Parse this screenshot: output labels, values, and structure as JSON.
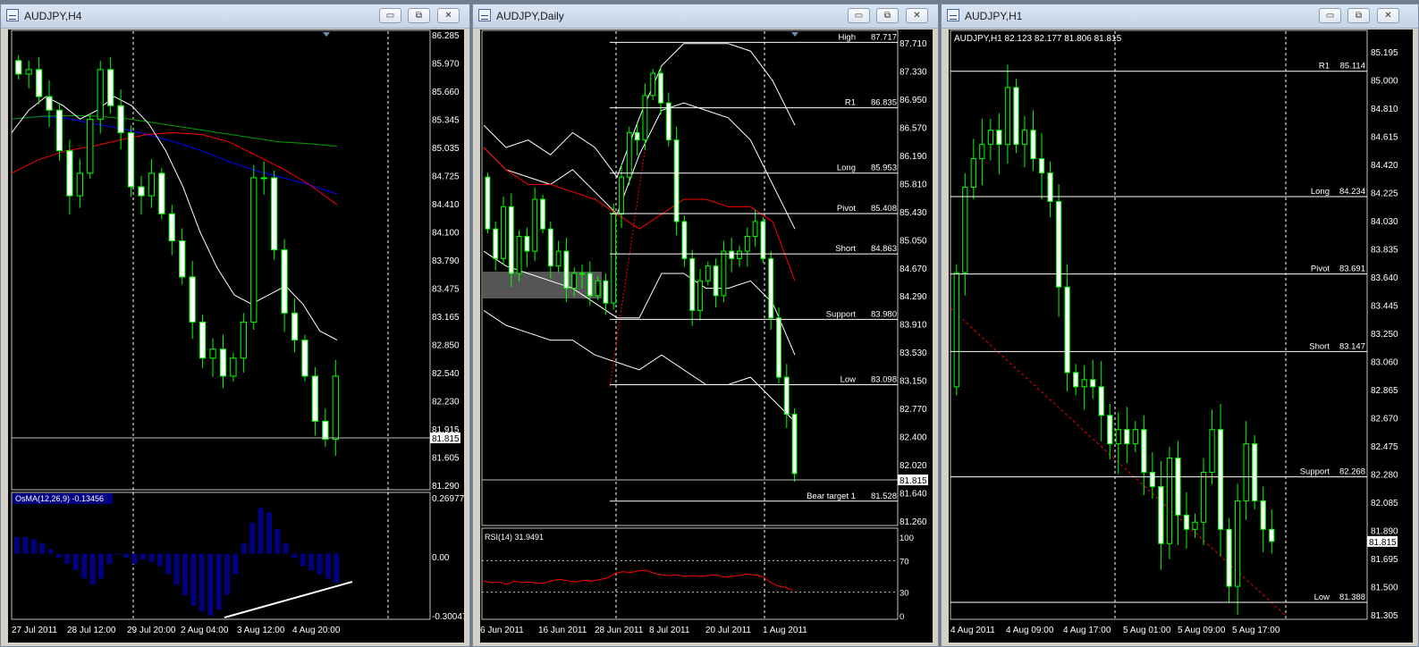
{
  "window_buttons": {
    "minimize": "▭",
    "restore": "⧉",
    "close": "✕"
  },
  "colors": {
    "bull": "#00ff00",
    "body": "#000000",
    "price_line": "#c0c0c0",
    "osma": "#000080",
    "rsi": "#ff0000",
    "ma_fast": "#ffffff",
    "ma_red": "#ff0000",
    "ma_blue": "#0000ff",
    "ma_green": "#00a000"
  },
  "windows": [
    {
      "title": "AUDJPY,H4",
      "chart_data": {
        "type": "candlestick",
        "title": "",
        "ylim": [
          81.29,
          86.285
        ],
        "y_ticks": [
          "86.285",
          "85.970",
          "85.660",
          "85.345",
          "85.035",
          "84.725",
          "84.410",
          "84.100",
          "83.790",
          "83.475",
          "83.165",
          "82.850",
          "82.540",
          "82.230",
          "81.915",
          "81.605",
          "81.290"
        ],
        "x_ticks": [
          "27 Jul 2011",
          "28 Jul 12:00",
          "29 Jul 20:00",
          "2 Aug 04:00",
          "3 Aug 12:00",
          "4 Aug 20:00"
        ],
        "current_price": "81.815",
        "close_path": [
          86.0,
          85.85,
          85.9,
          85.6,
          85.45,
          85.0,
          84.5,
          84.75,
          85.35,
          85.9,
          85.5,
          85.2,
          84.6,
          84.5,
          84.75,
          84.3,
          84.0,
          83.6,
          83.1,
          82.7,
          82.8,
          82.5,
          82.7,
          83.1,
          84.7,
          84.7,
          83.9,
          83.2,
          82.9,
          82.5,
          82.0,
          81.8,
          82.5
        ]
      },
      "osma": {
        "label": "OsMA(12,26,9) -0.13456",
        "ticks": [
          "0.26977",
          "0.00",
          "-0.30047"
        ],
        "values": [
          0.08,
          0.08,
          0.07,
          0.05,
          0.02,
          -0.02,
          -0.05,
          -0.08,
          -0.12,
          -0.15,
          -0.12,
          -0.05,
          0.0,
          -0.02,
          -0.05,
          -0.03,
          -0.04,
          -0.06,
          -0.1,
          -0.15,
          -0.2,
          -0.25,
          -0.28,
          -0.3,
          -0.27,
          -0.2,
          -0.1,
          0.05,
          0.15,
          0.22,
          0.2,
          0.12,
          0.05,
          -0.02,
          -0.06,
          -0.08,
          -0.1,
          -0.12,
          -0.14
        ]
      }
    },
    {
      "title": "AUDJPY,Daily",
      "chart_data": {
        "type": "candlestick",
        "title": "",
        "ylim": [
          81.26,
          87.71
        ],
        "y_ticks": [
          "87.710",
          "87.330",
          "86.950",
          "86.570",
          "86.190",
          "85.810",
          "85.430",
          "85.050",
          "84.670",
          "84.290",
          "83.910",
          "83.530",
          "83.150",
          "82.770",
          "82.400",
          "82.020",
          "81.640",
          "81.260"
        ],
        "x_ticks": [
          "6 Jun 2011",
          "16 Jun 2011",
          "28 Jun 2011",
          "8 Jul 2011",
          "20 Jul 2011",
          "1 Aug 2011"
        ],
        "current_price": "81.815",
        "levels": [
          {
            "label": "High",
            "value": "87.717"
          },
          {
            "label": "R1",
            "value": "86.835"
          },
          {
            "label": "Long",
            "value": "85.953"
          },
          {
            "label": "Pivot",
            "value": "85.408"
          },
          {
            "label": "Short",
            "value": "84.863"
          },
          {
            "label": "Support",
            "value": "83.980"
          },
          {
            "label": "Low",
            "value": "83.098"
          },
          {
            "label": "Bear target 1",
            "value": "81.528"
          }
        ],
        "close_path": [
          85.9,
          85.2,
          84.8,
          85.5,
          84.6,
          85.1,
          84.9,
          85.6,
          85.2,
          84.7,
          84.9,
          84.4,
          84.6,
          84.6,
          84.3,
          84.5,
          84.2,
          85.4,
          85.9,
          86.5,
          86.4,
          87.0,
          87.3,
          86.9,
          86.4,
          85.3,
          84.8,
          84.1,
          84.5,
          84.7,
          84.3,
          84.9,
          84.8,
          84.9,
          85.1,
          85.3,
          84.8,
          84.0,
          83.2,
          82.7,
          81.9
        ]
      },
      "rsi": {
        "label": "RSI(14) 31.9491",
        "ticks": [
          "100",
          "70",
          "30",
          "0"
        ],
        "values": [
          44,
          42,
          43,
          40,
          44,
          42,
          43,
          41,
          42,
          45,
          46,
          44,
          43,
          45,
          44,
          46,
          48,
          54,
          56,
          55,
          57,
          58,
          54,
          52,
          51,
          52,
          50,
          51,
          50,
          51,
          52,
          49,
          50,
          51,
          53,
          52,
          50,
          43,
          38,
          36,
          32
        ]
      }
    },
    {
      "title": "AUDJPY,H1",
      "ohlc_label": "AUDJPY,H1  82.123 82.177 81.806 81.815",
      "chart_data": {
        "type": "candlestick",
        "title": "",
        "ylim": [
          81.3,
          85.25
        ],
        "y_ticks": [
          "85.195",
          "85.000",
          "84.810",
          "84.615",
          "84.420",
          "84.225",
          "84.030",
          "83.835",
          "83.640",
          "83.445",
          "83.250",
          "83.060",
          "82.865",
          "82.670",
          "82.475",
          "82.280",
          "82.085",
          "81.890",
          "81.695",
          "81.500",
          "81.305"
        ],
        "x_ticks": [
          "4 Aug 2011",
          "4 Aug 09:00",
          "4 Aug 17:00",
          "5 Aug 01:00",
          "5 Aug 09:00",
          "5 Aug 17:00"
        ],
        "current_price": "81.815",
        "levels": [
          {
            "label": "R1",
            "value": "85.114"
          },
          {
            "label": "Long",
            "value": "84.234"
          },
          {
            "label": "Pivot",
            "value": "83.691"
          },
          {
            "label": "Short",
            "value": "83.147"
          },
          {
            "label": "Support",
            "value": "82.268"
          },
          {
            "label": "Low",
            "value": "81.388"
          }
        ],
        "close_path": [
          82.9,
          83.7,
          84.3,
          84.5,
          84.6,
          84.7,
          84.6,
          85.0,
          84.6,
          84.7,
          84.5,
          84.4,
          84.2,
          83.6,
          83.0,
          82.9,
          82.95,
          82.9,
          82.7,
          82.5,
          82.6,
          82.5,
          82.6,
          82.3,
          82.2,
          81.8,
          82.4,
          82.0,
          81.9,
          81.95,
          82.3,
          82.6,
          81.9,
          81.5,
          82.1,
          82.5,
          82.1,
          81.9,
          81.815
        ]
      }
    }
  ]
}
